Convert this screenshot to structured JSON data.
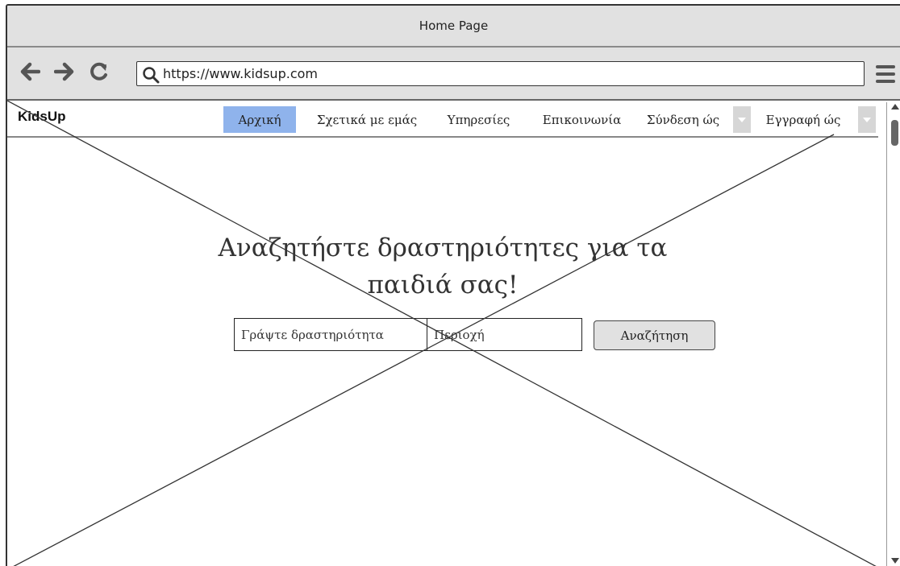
{
  "window": {
    "title": "Home Page"
  },
  "browser": {
    "url": "https://www.kidsup.com",
    "icons": [
      "back-arrow-icon",
      "forward-arrow-icon",
      "reload-icon",
      "search-icon",
      "hamburger-menu-icon"
    ]
  },
  "site": {
    "brand": "KidsUp",
    "nav": {
      "home": "Αρχική",
      "about": "Σχετικά με εμάς",
      "services": "Υπηρεσίες",
      "contact": "Επικοινωνία",
      "login": "Σύνδεση ώς",
      "register": "Εγγραφή ώς"
    },
    "active_nav": "home",
    "accent_color": "#8fb3ec"
  },
  "hero": {
    "title_line1": "Αναζητήστε δραστηριότητες για τα",
    "title_line2": "παιδιά σας!"
  },
  "search": {
    "activity_placeholder": "Γράψτε δραστηριότητα",
    "area_placeholder": "Περιοχή",
    "button_label": "Αναζήτηση"
  }
}
